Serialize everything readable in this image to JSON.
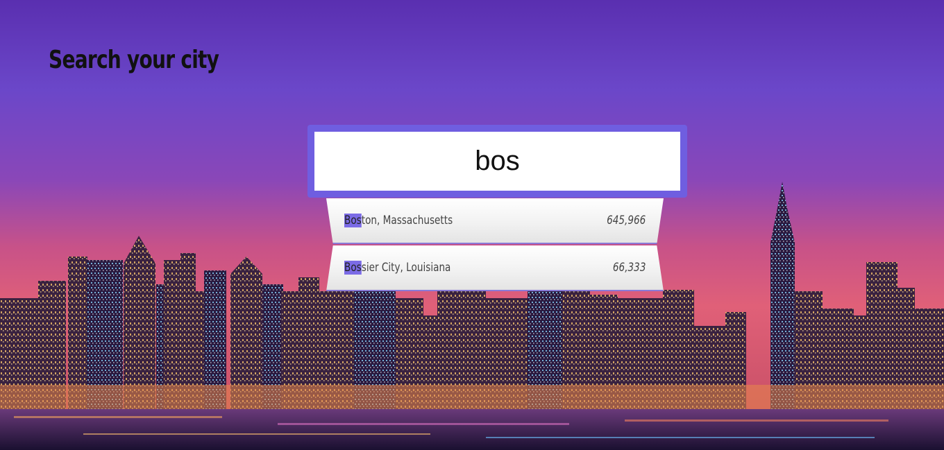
{
  "page": {
    "title": "Search your city"
  },
  "search": {
    "value": "bos",
    "placeholder": ""
  },
  "suggestions": [
    {
      "match": "Bos",
      "rest": "ton, Massachusetts",
      "population": "645,966"
    },
    {
      "match": "Bos",
      "rest": "sier City, Louisiana",
      "population": "66,333"
    }
  ],
  "colors": {
    "accent": "#6f5ee0",
    "highlight": "#7b6be6",
    "title_text": "#111111"
  },
  "icons": {
    "background": "city-skyline-image"
  }
}
